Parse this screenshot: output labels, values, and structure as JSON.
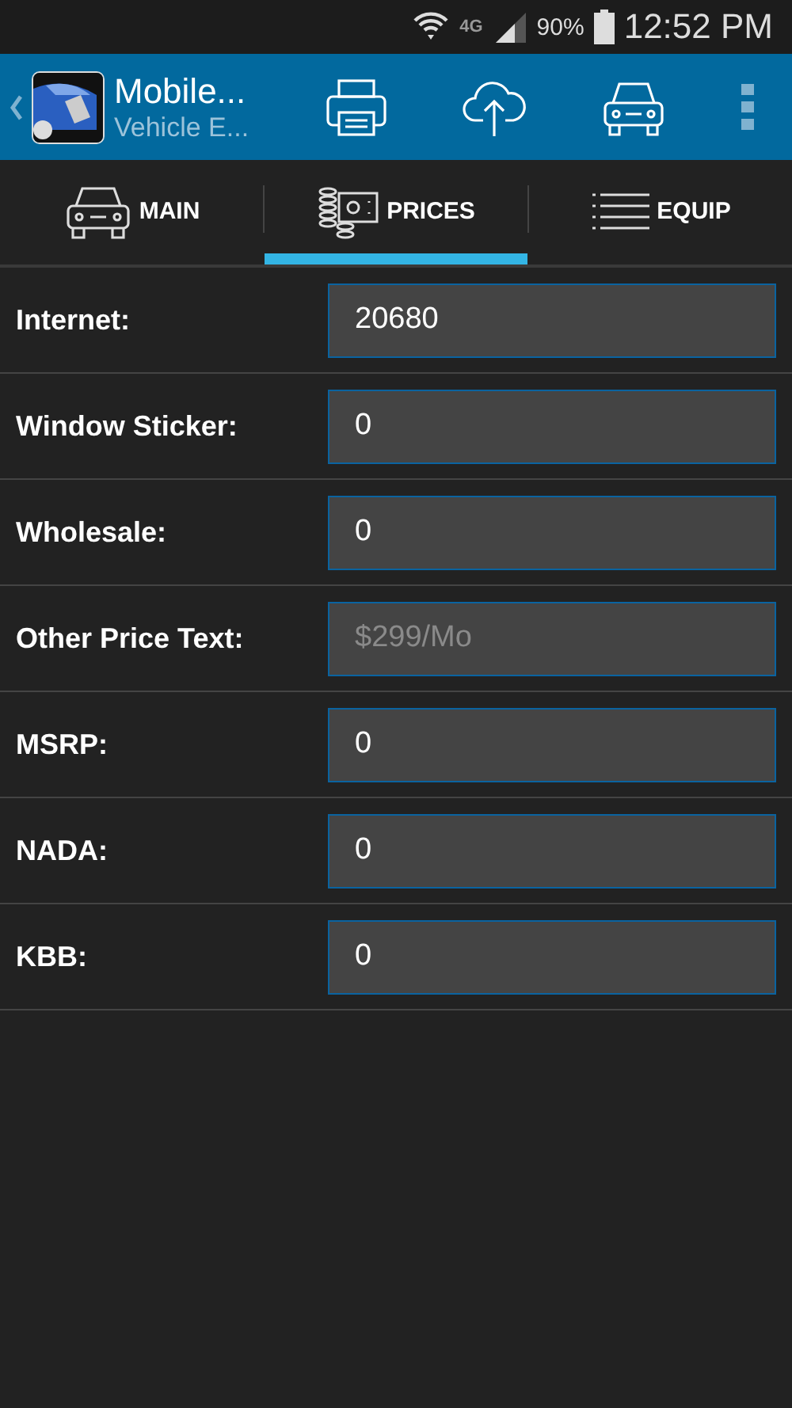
{
  "status_bar": {
    "network": "4G",
    "battery": "90%",
    "time": "12:52 PM"
  },
  "app_bar": {
    "title": "Mobile...",
    "subtitle": "Vehicle E..."
  },
  "tabs": [
    {
      "label": "MAIN",
      "kind": "car",
      "selected": false
    },
    {
      "label": "PRICES",
      "kind": "prices",
      "selected": true
    },
    {
      "label": "EQUIP",
      "kind": "list",
      "selected": false
    }
  ],
  "fields": [
    {
      "label": "Internet:",
      "value": "20680"
    },
    {
      "label": "Window Sticker:",
      "value": "0"
    },
    {
      "label": "Wholesale:",
      "value": "0"
    },
    {
      "label": "Other Price Text:",
      "placeholder": "$299/Mo"
    },
    {
      "label": "MSRP:",
      "value": "0"
    },
    {
      "label": "NADA:",
      "value": "0"
    },
    {
      "label": "KBB:",
      "value": "0"
    }
  ]
}
